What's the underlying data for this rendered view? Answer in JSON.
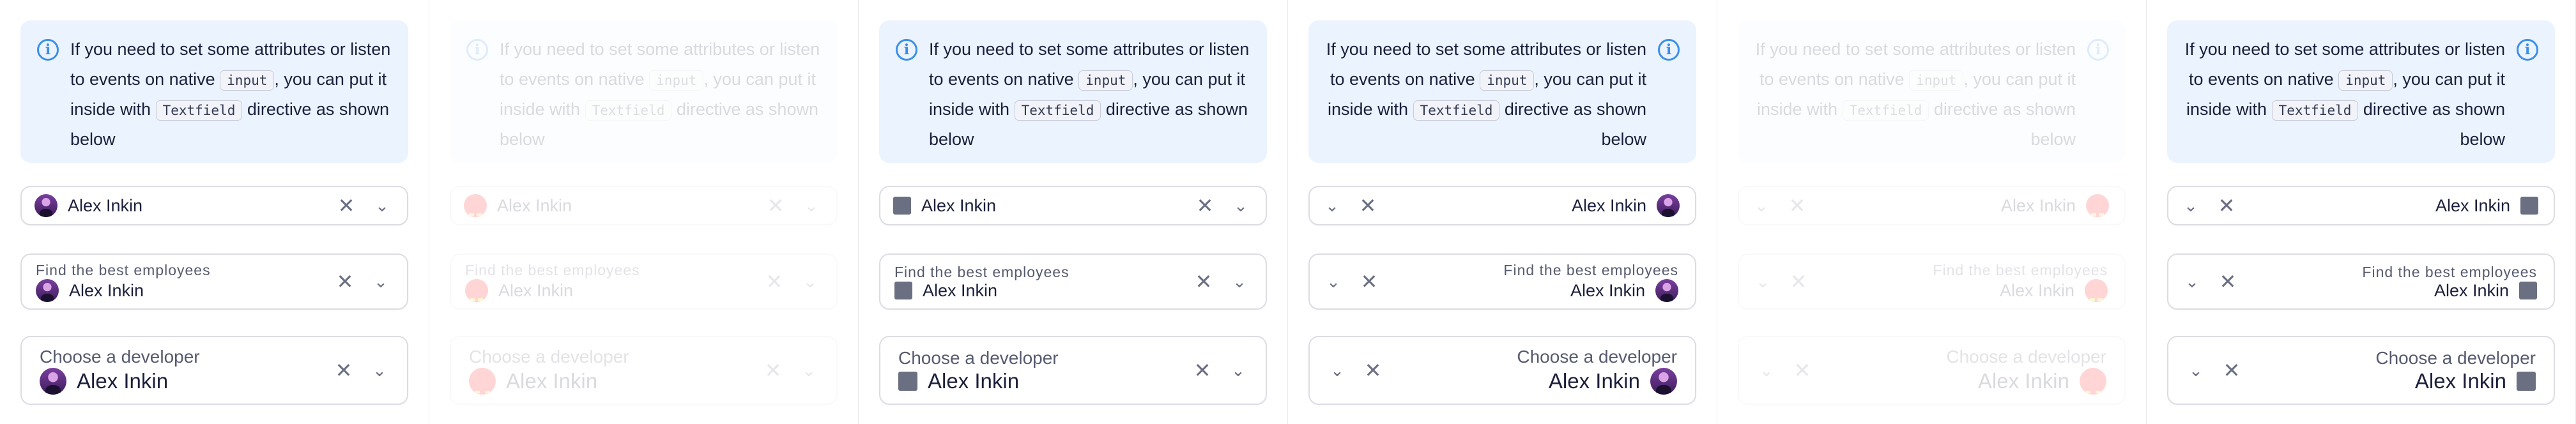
{
  "notice": {
    "text_1": "If you need to set some attributes or listen to events on native ",
    "code_1": "input",
    "text_2": ", you can put it inside with ",
    "code_2": "Textfield",
    "text_3": " directive as shown below"
  },
  "fields": {
    "value": "Alex Inkin",
    "small_label": "Find the best employees",
    "large_label": "Choose a developer"
  },
  "icons": {
    "info": "info-icon",
    "clear": "close-icon",
    "expand": "chevron-down-icon",
    "avatar": "avatar",
    "square": "square-icon"
  },
  "colors": {
    "notice_bg": "#eaf3fe",
    "info_blue": "#3b8fe8",
    "text": "#1b1f3b",
    "muted": "#565a6e",
    "border": "#dcdde3",
    "red_avatar": "#ff0000"
  },
  "glyphs": {
    "clear": "✕",
    "expand": "⌄",
    "info": "i"
  }
}
